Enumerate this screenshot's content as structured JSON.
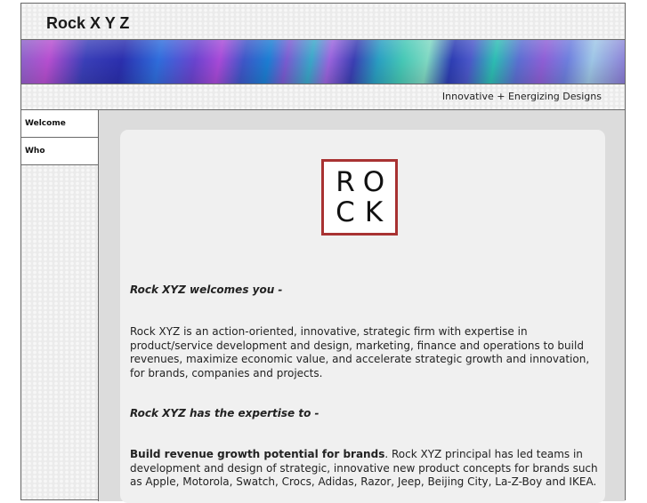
{
  "header": {
    "title": "Rock X Y Z",
    "tagline": "Innovative + Energizing Designs"
  },
  "sidebar": {
    "items": [
      {
        "label": "Welcome"
      },
      {
        "label": "Who"
      }
    ]
  },
  "logo": {
    "letters": [
      "R",
      "O",
      "C",
      "K"
    ],
    "border_color": "#a83232"
  },
  "content": {
    "welcome_heading": "Rock XYZ welcomes you -",
    "intro_paragraph": "Rock XYZ is an action-oriented, innovative, strategic firm with expertise in product/service development and design, marketing, finance and operations to build revenues, maximize economic value, and accelerate strategic growth and innovation, for brands, companies and projects.",
    "expertise_heading": "Rock XYZ has the expertise to -",
    "revenue_lead": "Build revenue growth potential for brands",
    "revenue_text": ".  Rock XYZ principal has led teams in development and design of strategic, innovative new product concepts for brands such as Apple, Motorola, Swatch, Crocs, Adidas, Razor, Jeep, Beijing City, La-Z-Boy and IKEA."
  }
}
